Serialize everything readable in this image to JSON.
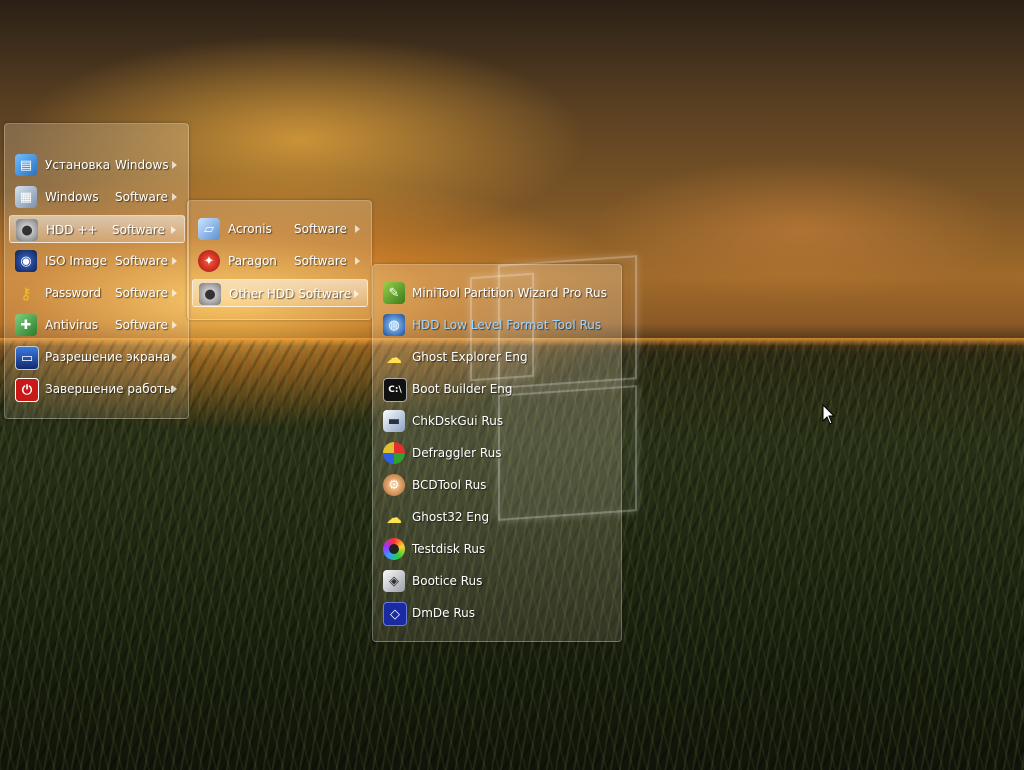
{
  "menu": {
    "items": [
      {
        "name": "Установка",
        "suffix": "Windows",
        "icon": "windows-setup-icon",
        "has_sub": true
      },
      {
        "name": "Windows",
        "suffix": "Software",
        "icon": "windows-software-icon",
        "has_sub": true
      },
      {
        "name": "HDD ++",
        "suffix": "Software",
        "icon": "hdd-icon",
        "has_sub": true,
        "active": true
      },
      {
        "name": "ISO Image",
        "suffix": "Software",
        "icon": "iso-icon",
        "has_sub": true
      },
      {
        "name": "Password",
        "suffix": "Software",
        "icon": "key-icon",
        "has_sub": true
      },
      {
        "name": "Antivirus",
        "suffix": "Software",
        "icon": "antivirus-icon",
        "has_sub": true
      },
      {
        "name": "Разрешение экрана",
        "suffix": "",
        "icon": "monitor-icon",
        "has_sub": true
      },
      {
        "name": "Завершение работы",
        "suffix": "",
        "icon": "power-icon",
        "has_sub": true
      }
    ]
  },
  "submenu_hdd": {
    "items": [
      {
        "name": "Acronis",
        "suffix": "Software",
        "icon": "acronis-icon"
      },
      {
        "name": "Paragon",
        "suffix": "Software",
        "icon": "paragon-icon"
      },
      {
        "name": "Other HDD Software",
        "suffix": "",
        "icon": "hdd-other-icon",
        "active": true
      }
    ]
  },
  "submenu_other": {
    "items": [
      {
        "label": "MiniTool Partition Wizard Pro Rus",
        "icon": "minitool-icon"
      },
      {
        "label": "HDD Low Level Format Tool Rus",
        "icon": "hddllf-icon",
        "hover": true
      },
      {
        "label": "Ghost Explorer Eng",
        "icon": "ghost-icon"
      },
      {
        "label": "Boot Builder Eng",
        "icon": "cmd-icon"
      },
      {
        "label": "ChkDskGui Rus",
        "icon": "disk-check-icon"
      },
      {
        "label": "Defraggler Rus",
        "icon": "defraggler-icon"
      },
      {
        "label": "BCDTool Rus",
        "icon": "bcdtool-icon"
      },
      {
        "label": "Ghost32 Eng",
        "icon": "ghost32-icon"
      },
      {
        "label": "Testdisk Rus",
        "icon": "testdisk-icon"
      },
      {
        "label": "Bootice Rus",
        "icon": "bootice-icon"
      },
      {
        "label": "DmDe Rus",
        "icon": "dmde-icon"
      }
    ]
  }
}
